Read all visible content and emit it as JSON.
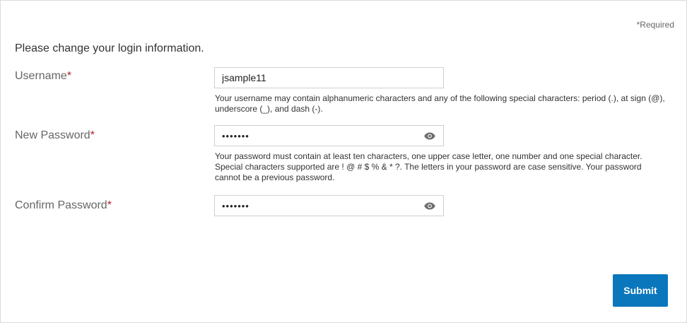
{
  "form": {
    "required_note": "*Required",
    "title": "Please change your login information.",
    "username": {
      "label": "Username",
      "required_mark": "*",
      "value": "jsample11",
      "help": "Your username may contain alphanumeric characters and any of the following special characters: period (.), at sign (@), underscore (_), and dash (-)."
    },
    "new_password": {
      "label": "New Password",
      "required_mark": "*",
      "value": "*******",
      "toggle_icon": "eye-icon",
      "help": "Your password must contain at least ten characters, one upper case letter, one number and one special character. Special characters supported are ! @ # $ % & * ?. The letters in your password are case sensitive. Your password cannot be a previous password."
    },
    "confirm_password": {
      "label": "Confirm Password",
      "required_mark": "*",
      "value": "*******",
      "toggle_icon": "eye-icon"
    },
    "submit_label": "Submit"
  },
  "colors": {
    "accent": "#0a77bd",
    "required": "#b21f2d"
  }
}
